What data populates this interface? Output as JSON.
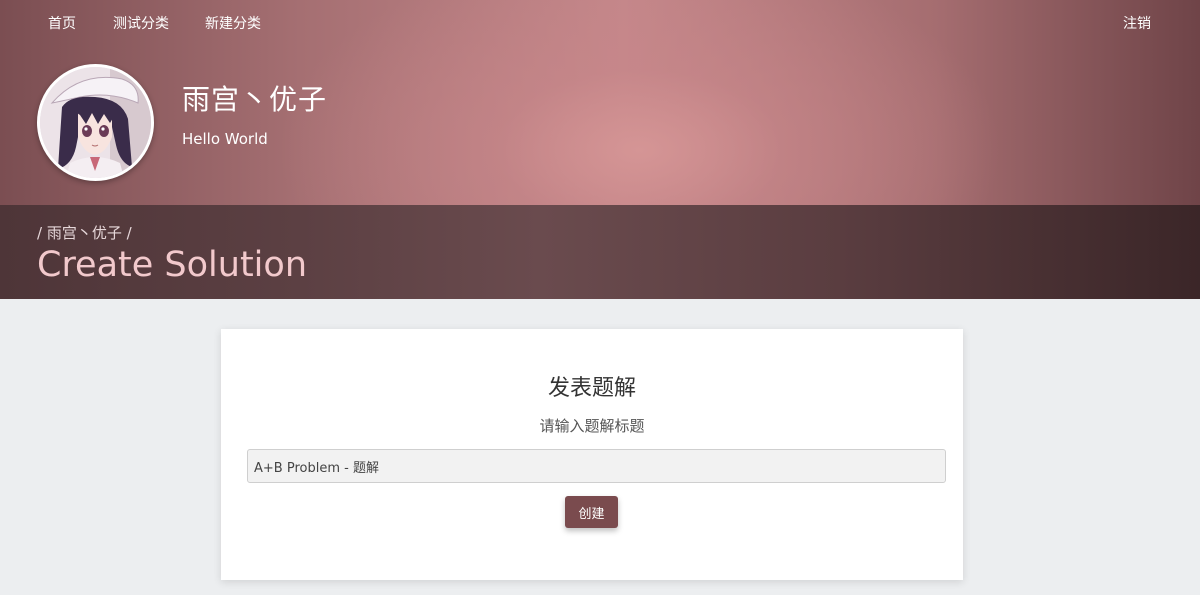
{
  "nav": {
    "items": [
      {
        "label": "首页"
      },
      {
        "label": "测试分类"
      },
      {
        "label": "新建分类"
      }
    ],
    "logout_label": "注销"
  },
  "profile": {
    "name": "雨宫丶优子",
    "motto": "Hello World",
    "avatar_icon": "anime-girl-avatar"
  },
  "header": {
    "breadcrumb": "/ 雨宫丶优子 /",
    "title": "Create Solution"
  },
  "form": {
    "heading": "发表题解",
    "label": "请输入题解标题",
    "title_value": "A+B Problem - 题解",
    "submit_label": "创建"
  },
  "colors": {
    "accent": "#7a4b4e",
    "title_pink": "#f2c9cc",
    "hero_mid": "#c4878a"
  }
}
